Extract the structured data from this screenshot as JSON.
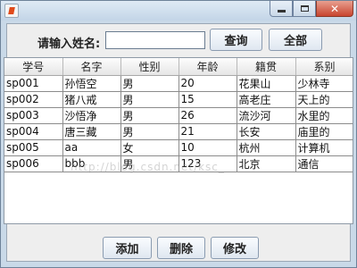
{
  "search": {
    "label": "请输入姓名:",
    "value": ""
  },
  "buttons": {
    "query": "查询",
    "all": "全部",
    "add": "添加",
    "delete": "删除",
    "edit": "修改"
  },
  "table": {
    "headers": [
      "学号",
      "名字",
      "性别",
      "年龄",
      "籍贯",
      "系别"
    ],
    "rows": [
      [
        "sp001",
        "孙悟空",
        "男",
        "20",
        "花果山",
        "少林寺"
      ],
      [
        "sp002",
        "猪八戒",
        "男",
        "15",
        "高老庄",
        "天上的"
      ],
      [
        "sp003",
        "沙悟净",
        "男",
        "26",
        "流沙河",
        "水里的"
      ],
      [
        "sp004",
        "唐三藏",
        "男",
        "21",
        "长安",
        "庙里的"
      ],
      [
        "sp005",
        "aa",
        "女",
        "10",
        "杭州",
        "计算机"
      ],
      [
        "sp006",
        "bbb",
        "男",
        "123",
        "北京",
        "通信"
      ]
    ]
  },
  "watermark": "http://blog.csdn.net/ksc_"
}
